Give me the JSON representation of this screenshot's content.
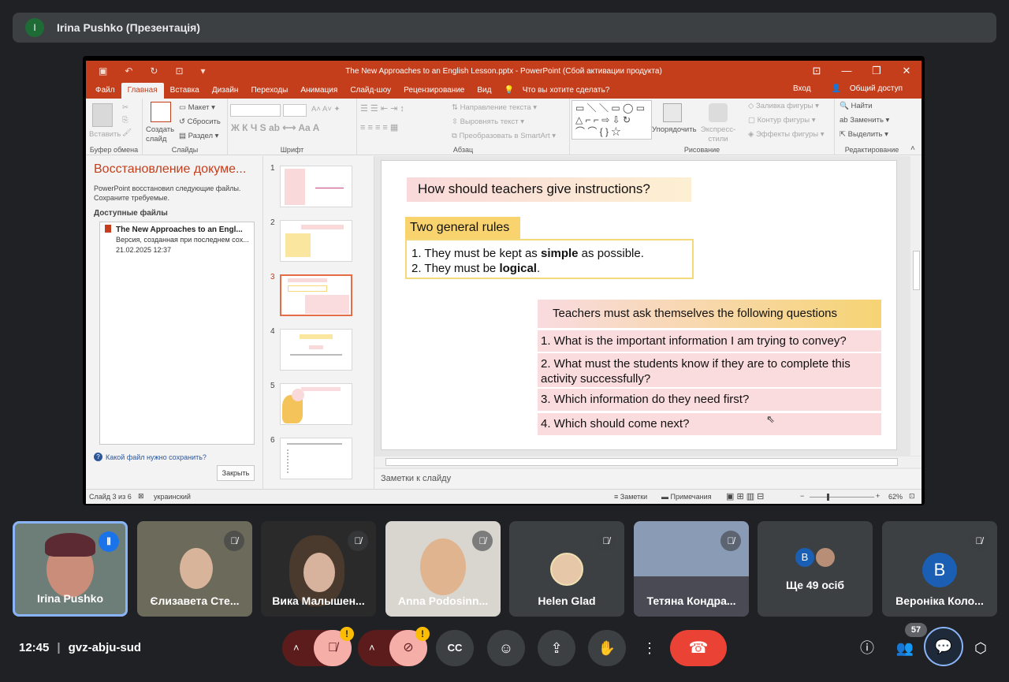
{
  "presenter": {
    "initial": "I",
    "name": "Irina Pushko (Презентація)"
  },
  "ppt": {
    "title": "The New Approaches to an English Lesson.pptx - PowerPoint (Сбой активации продукта)",
    "tabs": [
      "Файл",
      "Главная",
      "Вставка",
      "Дизайн",
      "Переходы",
      "Анимация",
      "Слайд-шоу",
      "Рецензирование",
      "Вид",
      "Что вы хотите сделать?"
    ],
    "signin": "Вход",
    "share": "Общий доступ",
    "ribbon": {
      "paste": "Вставить",
      "new_slide": "Создать слайд",
      "layout": "Макет",
      "reset": "Сбросить",
      "section": "Раздел",
      "text_direction": "Направление текста",
      "align_text": "Выровнять текст",
      "smartart": "Преобразовать в SmartArt",
      "arrange": "Упорядочить",
      "quick_styles": "Экспресс-стили",
      "shape_fill": "Заливка фигуры",
      "shape_outline": "Контур фигуры",
      "shape_effects": "Эффекты фигуры",
      "find": "Найти",
      "replace": "Заменить",
      "select": "Выделить",
      "groups": [
        "Буфер обмена",
        "Слайды",
        "Шрифт",
        "Абзац",
        "Рисование",
        "Редактирование"
      ]
    },
    "recovery": {
      "title": "Восстановление докуме...",
      "desc": "PowerPoint восстановил следующие файлы. Сохраните требуемые.",
      "available": "Доступные файлы",
      "file_name": "The New Approaches to an Engl...",
      "file_version": "Версия, созданная при последнем сох...",
      "file_date": "21.02.2025 12:37",
      "question": "Какой файл нужно сохранить?",
      "close": "Закрыть"
    },
    "thumbnails": [
      "1",
      "2",
      "3",
      "4",
      "5",
      "6"
    ],
    "slide": {
      "question": "How should teachers give instructions?",
      "rules_heading": "Two general rules",
      "rule1_pre": "1. They must be kept as ",
      "rule1_bold": "simple",
      "rule1_post": " as possible.",
      "rule2_pre": "2. They must be ",
      "rule2_bold": "logical",
      "rule2_post": ".",
      "questions_heading": "Teachers must ask themselves  the following questions",
      "q1": "1. What is the important information I am trying to convey?",
      "q2": "2. What must the students know if they are to complete this activity successfully?",
      "q3": "3. Which information do they need first?",
      "q4": "4. Which should come next?"
    },
    "notes": "Заметки к слайду",
    "status": {
      "slide": "Слайд 3 из 6",
      "lang": "украинский",
      "notes": "Заметки",
      "comments": "Примечания",
      "zoom": "62%"
    }
  },
  "participants": [
    {
      "name": "Irina Pushko",
      "speaking": true
    },
    {
      "name": "Єлизавета Сте..."
    },
    {
      "name": "Вика Малышен..."
    },
    {
      "name": "Anna Podosinn..."
    },
    {
      "name": "Helen Glad"
    },
    {
      "name": "Тетяна Кондра..."
    },
    {
      "name": "Ще 49 осіб",
      "avatar_initial": "B"
    },
    {
      "name": "Вероніка Коло...",
      "avatar_initial": "B"
    }
  ],
  "meeting": {
    "time": "12:45",
    "code": "gvz-abju-sud",
    "participant_count": "57",
    "warn_mark": "!"
  },
  "colors": {
    "ppt_accent": "#c43e1c",
    "end_call": "#ea4335",
    "mic_off_bg": "#8c1d18",
    "speaking_border": "#8ab4f8"
  }
}
